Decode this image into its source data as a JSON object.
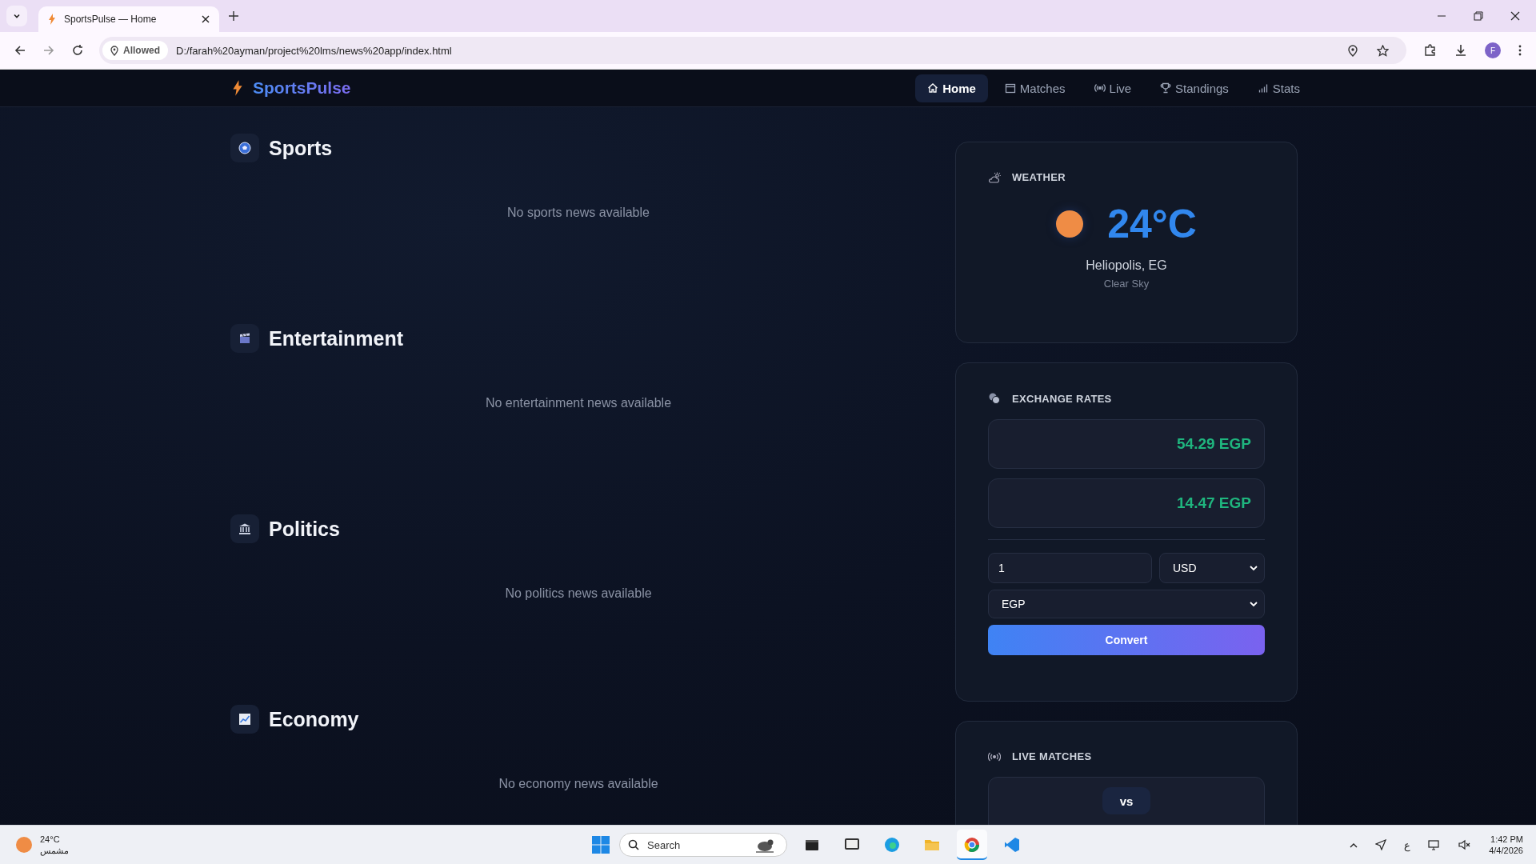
{
  "browser": {
    "tab_title": "SportsPulse — Home",
    "permission": "Allowed",
    "url": "D:/farah%20ayman/project%20lms/news%20app/index.html",
    "profile_initial": "F"
  },
  "nav": {
    "brand": "SportsPulse",
    "links": [
      {
        "label": "Home",
        "selected": true
      },
      {
        "label": "Matches",
        "selected": false
      },
      {
        "label": "Live",
        "selected": false
      },
      {
        "label": "Standings",
        "selected": false
      },
      {
        "label": "Stats",
        "selected": false
      }
    ]
  },
  "sections": [
    {
      "title": "Sports",
      "empty_message": "No sports news available"
    },
    {
      "title": "Entertainment",
      "empty_message": "No entertainment news available"
    },
    {
      "title": "Politics",
      "empty_message": "No politics news available"
    },
    {
      "title": "Economy",
      "empty_message": "No economy news available"
    }
  ],
  "weather": {
    "heading": "WEATHER",
    "temperature": "24°C",
    "location": "Heliopolis, EG",
    "condition": "Clear Sky"
  },
  "exchange": {
    "heading": "EXCHANGE RATES",
    "rates": [
      {
        "value": "54.29 EGP"
      },
      {
        "value": "14.47 EGP"
      }
    ],
    "amount": "1",
    "from": "USD",
    "to": "EGP",
    "button": "Convert"
  },
  "live": {
    "heading": "LIVE MATCHES",
    "vs": "vs"
  },
  "taskbar": {
    "temperature": "24°C",
    "condition": "مشمس",
    "search_placeholder": "Search",
    "ime": "ع",
    "time": "1:42 PM",
    "date": "4/4/2026",
    "apps": [
      {
        "selected": false
      },
      {
        "selected": false
      },
      {
        "selected": false
      },
      {
        "selected": false
      },
      {
        "selected": true
      },
      {
        "selected": false
      }
    ]
  }
}
